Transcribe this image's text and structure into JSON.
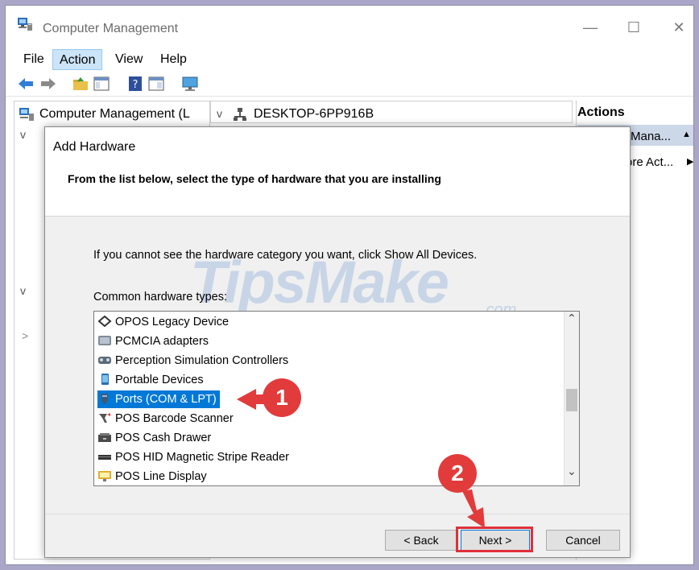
{
  "window": {
    "title": "Computer Management",
    "minimize": "—",
    "maximize": "☐",
    "close": "✕"
  },
  "menu": [
    "File",
    "Action",
    "View",
    "Help"
  ],
  "tree": {
    "root_label": "Computer Management (L",
    "chev1": "v",
    "chev2": "v",
    "chev3": ">"
  },
  "center": {
    "computer_name": "DESKTOP-6PP916B",
    "chevron": "v"
  },
  "actions": {
    "title": "Actions",
    "sub_item": "Mana...",
    "more_item": "ore Act...",
    "up_arrow": "▲",
    "right_arrow": "▶"
  },
  "dialog": {
    "title": "Add Hardware",
    "subtitle": "From the list below, select the type of hardware that you are installing",
    "info": "If you cannot see the hardware category you want, click Show All Devices.",
    "list_label": "Common hardware types:",
    "items": [
      {
        "label": "OPOS Legacy Device",
        "icon": "opos-icon"
      },
      {
        "label": "PCMCIA adapters",
        "icon": "pcmcia-icon"
      },
      {
        "label": "Perception Simulation Controllers",
        "icon": "perception-icon"
      },
      {
        "label": "Portable Devices",
        "icon": "portable-device-icon"
      },
      {
        "label": "Ports (COM & LPT)",
        "icon": "port-icon",
        "selected": true
      },
      {
        "label": "POS Barcode Scanner",
        "icon": "barcode-scanner-icon"
      },
      {
        "label": "POS Cash Drawer",
        "icon": "cash-drawer-icon"
      },
      {
        "label": "POS HID Magnetic Stripe Reader",
        "icon": "stripe-reader-icon"
      },
      {
        "label": "POS Line Display",
        "icon": "line-display-icon"
      }
    ],
    "scroll_up": "⌃",
    "scroll_down": "⌄",
    "back_button": "< Back",
    "next_button": "Next >",
    "cancel_button": "Cancel"
  },
  "annotations": {
    "step1": "1",
    "step2": "2"
  },
  "watermark": {
    "main": "TipsMake",
    "suffix": ".com"
  },
  "colors": {
    "selection": "#0078d7",
    "annotation": "#e23b3b"
  }
}
